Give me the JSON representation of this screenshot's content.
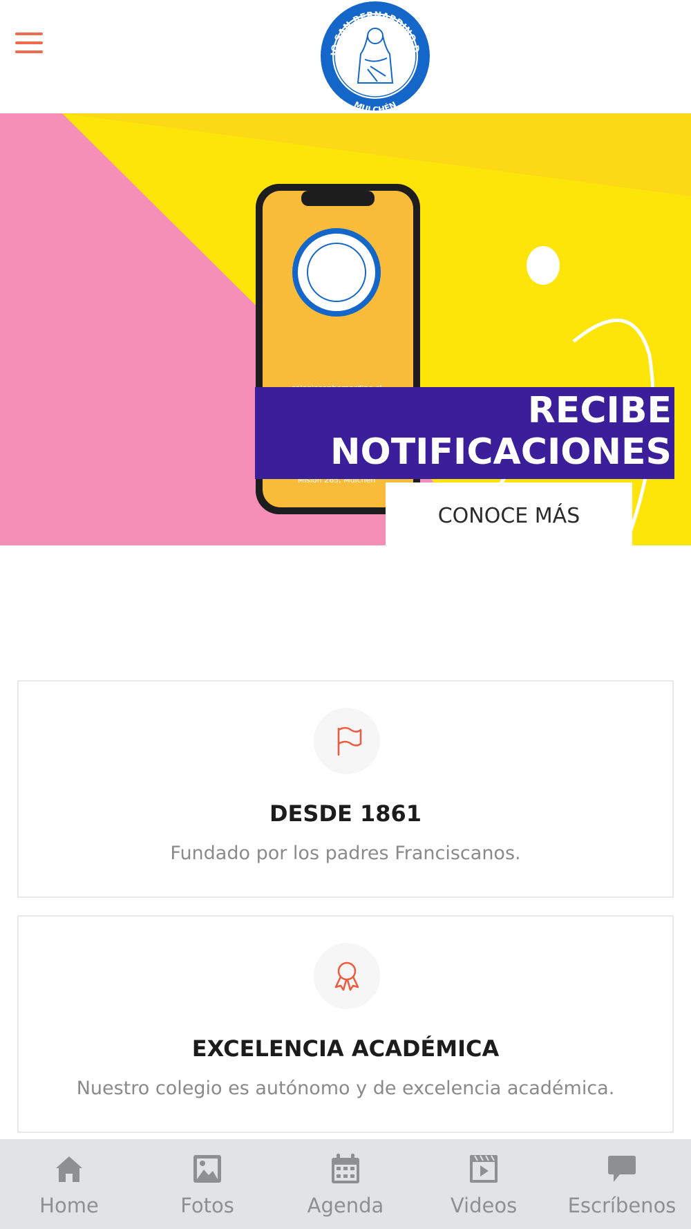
{
  "header": {
    "menu_icon": "hamburger-icon",
    "logo": {
      "top_text": "COLEGIO SAN BERNARDINO DE SENA",
      "bottom_text": "MULCHÉN"
    }
  },
  "hero": {
    "title_line1": "RECIBE",
    "title_line2": "NOTIFICACIONES",
    "cta_label": "CONOCE MÁS",
    "phone_text_url": "colegiosanbernardino.cl",
    "phone_text_address": "Misión 265, Mulchén",
    "colors": {
      "pink": "#f58fb8",
      "yellow": "#fde50a",
      "banner": "#3a1e9a"
    }
  },
  "features": [
    {
      "icon": "flag-icon",
      "title": "DESDE 1861",
      "text": "Fundado por los padres Franciscanos."
    },
    {
      "icon": "award-ribbon-icon",
      "title": "EXCELENCIA ACADÉMICA",
      "text": "Nuestro colegio es autónomo y de excelencia académica."
    }
  ],
  "tabbar": {
    "tabs": [
      {
        "label": "Home",
        "icon": "home-icon"
      },
      {
        "label": "Fotos",
        "icon": "image-icon"
      },
      {
        "label": "Agenda",
        "icon": "calendar-icon"
      },
      {
        "label": "Videos",
        "icon": "video-icon"
      },
      {
        "label": "Escríbenos",
        "icon": "comment-icon"
      }
    ]
  },
  "accent_color": "#ef6b4f"
}
